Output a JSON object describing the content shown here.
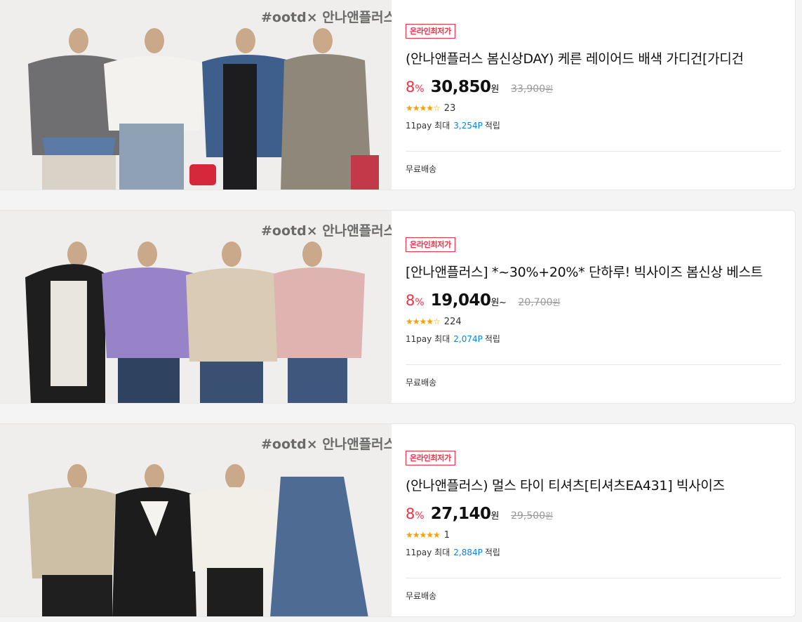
{
  "products": [
    {
      "badge": "온라인최저가",
      "title": "(안나앤플러스 봄신상DAY) 케른 레이어드 배색 가디건[가디건",
      "discount": "8",
      "discount_unit": "%",
      "price": "30,850",
      "price_unit": "원",
      "price_suffix": "",
      "original_price": "33,900",
      "original_unit": "원",
      "stars": "★★★★☆",
      "rating": 4.5,
      "review_count": "23",
      "pay_label": "11pay 최대",
      "points": "3,254P",
      "points_suffix": "적립",
      "shipping": "무료배송",
      "brand_mark": "#ootd×안나앤플러스"
    },
    {
      "badge": "온라인최저가",
      "title": "[안나앤플러스] *~30%+20%* 단하루! 빅사이즈 봄신상 베스트",
      "discount": "8",
      "discount_unit": "%",
      "price": "19,040",
      "price_unit": "원",
      "price_suffix": "~",
      "original_price": "20,700",
      "original_unit": "원",
      "stars": "★★★★☆",
      "rating": 4.5,
      "review_count": "224",
      "pay_label": "11pay 최대",
      "points": "2,074P",
      "points_suffix": "적립",
      "shipping": "무료배송",
      "brand_mark": "#ootd×안나앤플러스"
    },
    {
      "badge": "온라인최저가",
      "title": "(안나앤플러스) 멀스 타이 티셔츠[티셔츠EA431] 빅사이즈",
      "discount": "8",
      "discount_unit": "%",
      "price": "27,140",
      "price_unit": "원",
      "price_suffix": "",
      "original_price": "29,500",
      "original_unit": "원",
      "stars": "★★★★★",
      "rating": 5,
      "review_count": "1",
      "pay_label": "11pay 최대",
      "points": "2,884P",
      "points_suffix": "적립",
      "shipping": "무료배송",
      "brand_mark": "#ootd×안나앤플러스"
    }
  ],
  "colors": {
    "accent_red": "#f43142",
    "point_blue": "#0b83e6",
    "star_yellow": "#f5a200"
  }
}
